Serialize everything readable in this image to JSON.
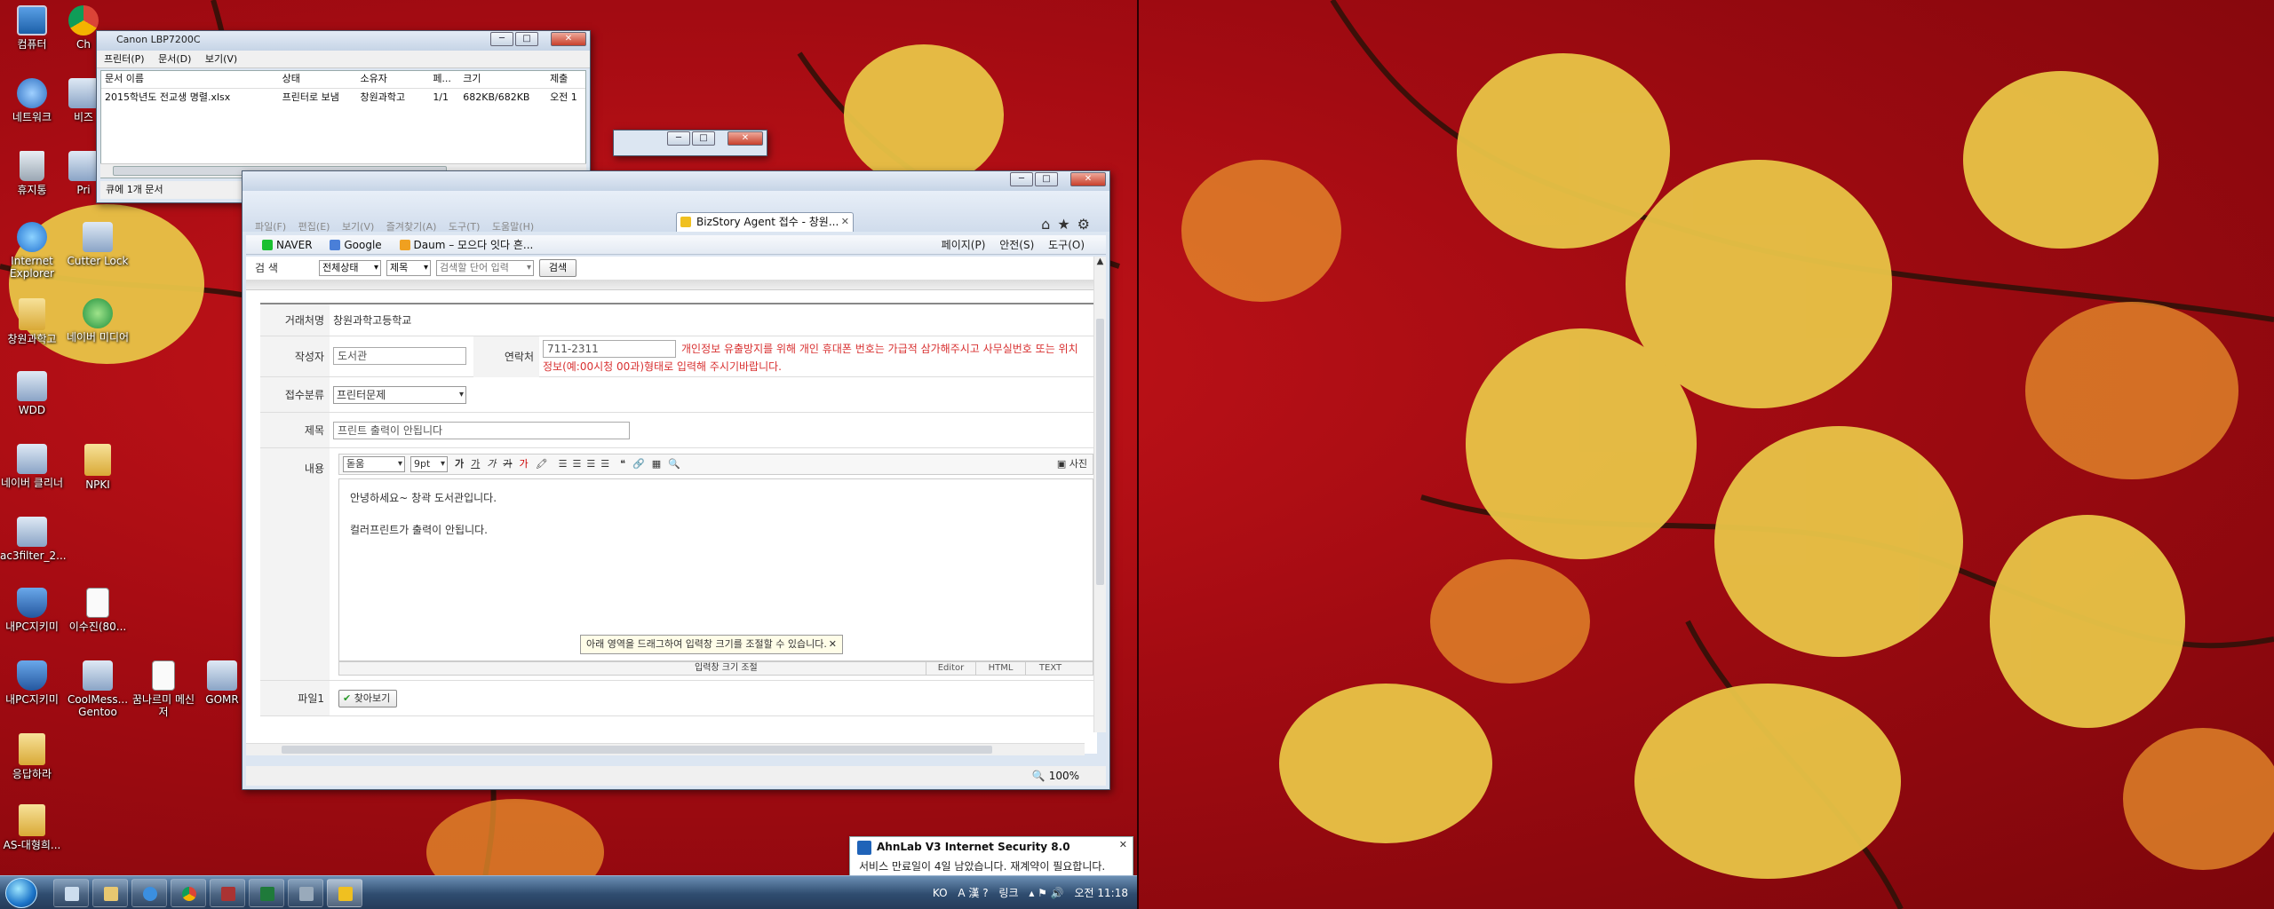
{
  "desktop": {
    "icons": [
      {
        "label": "컴퓨터"
      },
      {
        "label": "Ch"
      },
      {
        "label": "네트워크"
      },
      {
        "label": "비즈"
      },
      {
        "label": "휴지통"
      },
      {
        "label": "Pri"
      },
      {
        "label": "Internet Explorer"
      },
      {
        "label": "Cutter Lock"
      },
      {
        "label": "창원과학고"
      },
      {
        "label": "네이버 미디어"
      },
      {
        "label": "WDD"
      },
      {
        "label": "네이버 클리너"
      },
      {
        "label": "NPKI"
      },
      {
        "label": "ac3filter_2..."
      },
      {
        "label": "내PC지키미"
      },
      {
        "label": "이수진(80..."
      },
      {
        "label": "내PC지키미"
      },
      {
        "label": "CoolMess... Gentoo"
      },
      {
        "label": "꿈나르미 메신저"
      },
      {
        "label": "GOMR"
      },
      {
        "label": "응답하라"
      },
      {
        "label": "AS-대형희..."
      }
    ]
  },
  "printer_window": {
    "title": "Canon LBP7200C",
    "menu": [
      "프린터(P)",
      "문서(D)",
      "보기(V)"
    ],
    "columns": [
      "문서 이름",
      "상태",
      "소유자",
      "페...",
      "크기",
      "제출"
    ],
    "rows": [
      {
        "name": "2015학년도 전교생 명렬.xlsx",
        "status": "프린터로 보냄",
        "owner": "창원과학고",
        "pages": "1/1",
        "size": "682KB/682KB",
        "submitted": "오전 1"
      }
    ],
    "status": "큐에 1개 문서"
  },
  "browser": {
    "tab_title": "BizStory Agent 접수 - 창원...",
    "menu": [
      "파일(F)",
      "편집(E)",
      "보기(V)",
      "즐겨찾기(A)",
      "도구(T)",
      "도움말(H)"
    ],
    "favorites": [
      {
        "label": "NAVER",
        "color": "#19c030"
      },
      {
        "label": "Google",
        "color": "#4a7fd8"
      },
      {
        "label": "Daum – 모으다 잇다 흔...",
        "color": "#f0a020"
      }
    ],
    "commands": [
      "페이지(P)",
      "안전(S)",
      "도구(O)"
    ],
    "zoom": "100%"
  },
  "page": {
    "search": {
      "label": "검 색",
      "status_select": "전체상태",
      "field_select": "제목",
      "input_placeholder": "검색할 단어 입력",
      "button": "검색"
    },
    "form": {
      "client_label": "거래처명",
      "client_value": "창원과학고등학교",
      "writer_label": "작성자",
      "writer_value": "도서관",
      "contact_label": "연락처",
      "contact_value": "711-2311",
      "privacy_notice_1": "개인정보 유출방지를 위해 개인 휴대폰 번호는 가급적 삼가해주시고 사무실번호 또는 위치",
      "privacy_notice_2": "정보(예:00시청 00과)형태로 입력해 주시기바랍니다.",
      "category_label": "접수분류",
      "category_value": "프린터문제",
      "subject_label": "제목",
      "subject_value": "프린트 출력이 안됩니다",
      "content_label": "내용",
      "editor_font": "돋움",
      "editor_size": "9pt",
      "editor_photo": "사진",
      "body_line1": "안녕하세요~ 창곽 도서관입니다.",
      "body_line2": "컬러프린트가 출력이 안됩니다.",
      "tooltip": "아래 영역을 드래그하여 입력창 크기를 조절할 수 있습니다.",
      "resize_label": "입력창 크기 조절",
      "modes": [
        "Editor",
        "HTML",
        "TEXT"
      ],
      "file_label": "파일1",
      "find_button": "찾아보기"
    }
  },
  "notification": {
    "title": "AhnLab V3 Internet Security 8.0",
    "message": "서비스 만료일이 4일 남았습니다. 재계약이 필요합니다."
  },
  "taskbar": {
    "tray_lang": "KO",
    "tray_link": "링크",
    "clock": "오전 11:18"
  }
}
